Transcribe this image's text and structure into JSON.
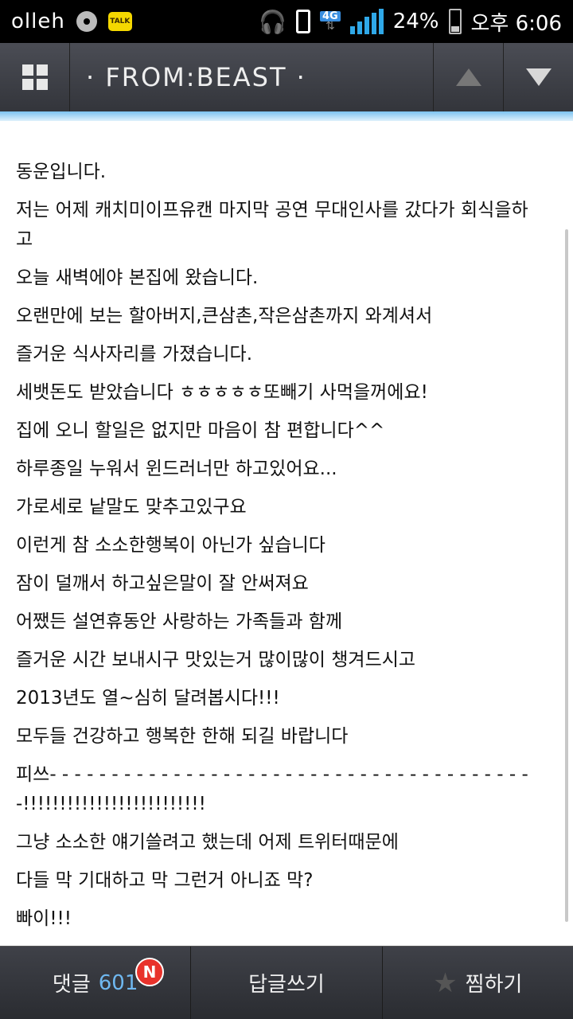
{
  "status_bar": {
    "carrier": "olleh",
    "kakao_label": "TALK",
    "network": "4G",
    "battery": "24%",
    "time": "오후 6:06"
  },
  "header": {
    "title": "· FROM:BEAST ·"
  },
  "post": {
    "lines": [
      "동운입니다.",
      "저는 어제 캐치미이프유캔 마지막 공연 무대인사를 갔다가 회식을하고",
      "오늘 새벽에야 본집에 왔습니다.",
      "오랜만에 보는 할아버지,큰삼촌,작은삼촌까지 와계셔서",
      "즐거운 식사자리를 가졌습니다.",
      "세뱃돈도 받았습니다 ㅎㅎㅎㅎㅎ또빼기 사먹을꺼에요!",
      "집에 오니 할일은 없지만 마음이 참 편합니다^^",
      "하루종일 누워서 윈드러너만 하고있어요...",
      "가로세로 낱말도 맞추고있구요",
      "이런게 참 소소한행복이 아닌가 싶습니다",
      "잠이 덜깨서 하고싶은말이 잘 안써져요",
      "어쨌든 설연휴동안 사랑하는 가족들과 함께",
      "즐거운 시간 보내시구 맛있는거 많이많이 챙겨드시고",
      "2013년도 열~심히 달려봅시다!!!",
      "모두들 건강하고 행복한 한해 되길 바랍니다",
      "피쓰- - - - - - - - - - - - - - - - - - - - - - - - - - - - - - - - - - - - - - - -!!!!!!!!!!!!!!!!!!!!!!!!!",
      "그냥 소소한 얘기쓸려고 했는데 어제 트위터때문에",
      "다들 막 기대하고 막 그런거 아니죠 막?",
      "빠이!!!"
    ]
  },
  "bottom_bar": {
    "comments_label": "댓글",
    "comments_count": "601",
    "new_badge": "N",
    "reply_label": "답글쓰기",
    "favorite_label": "찜하기"
  }
}
